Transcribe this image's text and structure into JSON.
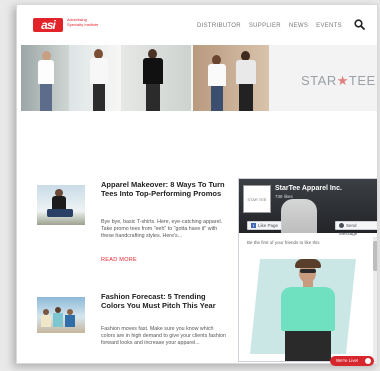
{
  "header": {
    "logo_text": "asi",
    "tagline": "Advertising Specialty Institute",
    "nav": [
      "DISTRIBUTOR",
      "SUPPLIER",
      "NEWS",
      "EVENTS"
    ]
  },
  "banner": {
    "brand_left": "STAR",
    "brand_star": "★",
    "brand_right": "TEE"
  },
  "articles": [
    {
      "title": "Apparel Makeover: 8 Ways To Turn Tees Into Top-Performing Promos",
      "excerpt": "Bye bye, basic T-shirts. Here, eye-catching apparel. Take promo tees from \"eeh\" to \"gotta have it\" with these handcrafting styles. Here's...",
      "read_more": "READ MORE"
    },
    {
      "title": "Fashion Forecast: 5 Trending Colors You Must Pitch This Year",
      "excerpt": "Fashion moves fast. Make sure you know which colors are in high demand to give your clients fashion forward looks and increase your apparel..."
    }
  ],
  "facebook": {
    "avatar_text": "STAR TEE",
    "page_name": "StarTee Apparel Inc.",
    "likes": "738 likes",
    "like_button": "Like Page",
    "message_button": "Send Message",
    "friends_text": "Be the first of your friends to like this"
  },
  "chat": {
    "label": "We're Live!"
  },
  "colors": {
    "accent": "#e2232a",
    "fb_blue": "#4267b2"
  }
}
